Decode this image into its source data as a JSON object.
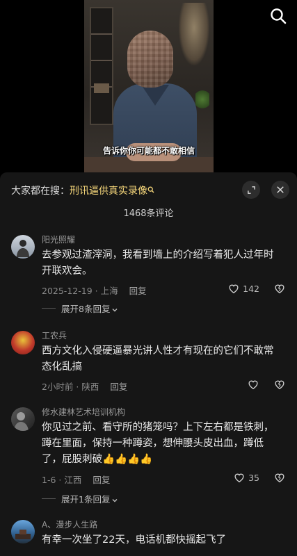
{
  "video": {
    "subtitle": "告诉你你可能都不敢相信"
  },
  "trending": {
    "prefix": "大家都在搜：",
    "term": "刑讯逼供真实录像"
  },
  "comment_count": "1468条评论",
  "comments": [
    {
      "username": "阳光照耀",
      "text": "去参观过渣滓洞，我看到墙上的介绍写着犯人过年时开联欢会。",
      "time": "2025-12-19 · 上海",
      "reply_label": "回复",
      "likes": "142",
      "expand": "展开8条回复"
    },
    {
      "username": "工农兵",
      "text": "西方文化入侵硬逼暴光讲人性才有现在的它们不敢常态化乱搞",
      "time": "2小时前 · 陕西",
      "reply_label": "回复",
      "likes": ""
    },
    {
      "username": "修水建林艺术培训机构",
      "text": "你见过之前、看守所的猪笼吗？上下左右都是铁刺，蹲在里面，保持一种蹲姿，想伸腰头皮出血，蹲低了，屁股刺破👍👍👍👍",
      "time": "1-6 · 江西",
      "reply_label": "回复",
      "likes": "35",
      "expand": "展开1条回复"
    },
    {
      "username": "A、漫步人生路",
      "text": "有幸一次坐了22天，电话机都快摇起飞了"
    }
  ],
  "icons": {
    "search": "search-icon",
    "magnifier": "magnifier-icon",
    "expand": "expand-icon",
    "close": "close-icon",
    "like": "heart-icon",
    "dislike": "broken-heart-icon",
    "chevron": "chevron-down-icon"
  },
  "colors": {
    "trend_term": "#f5d67a",
    "sheet_bg": "#161616"
  }
}
